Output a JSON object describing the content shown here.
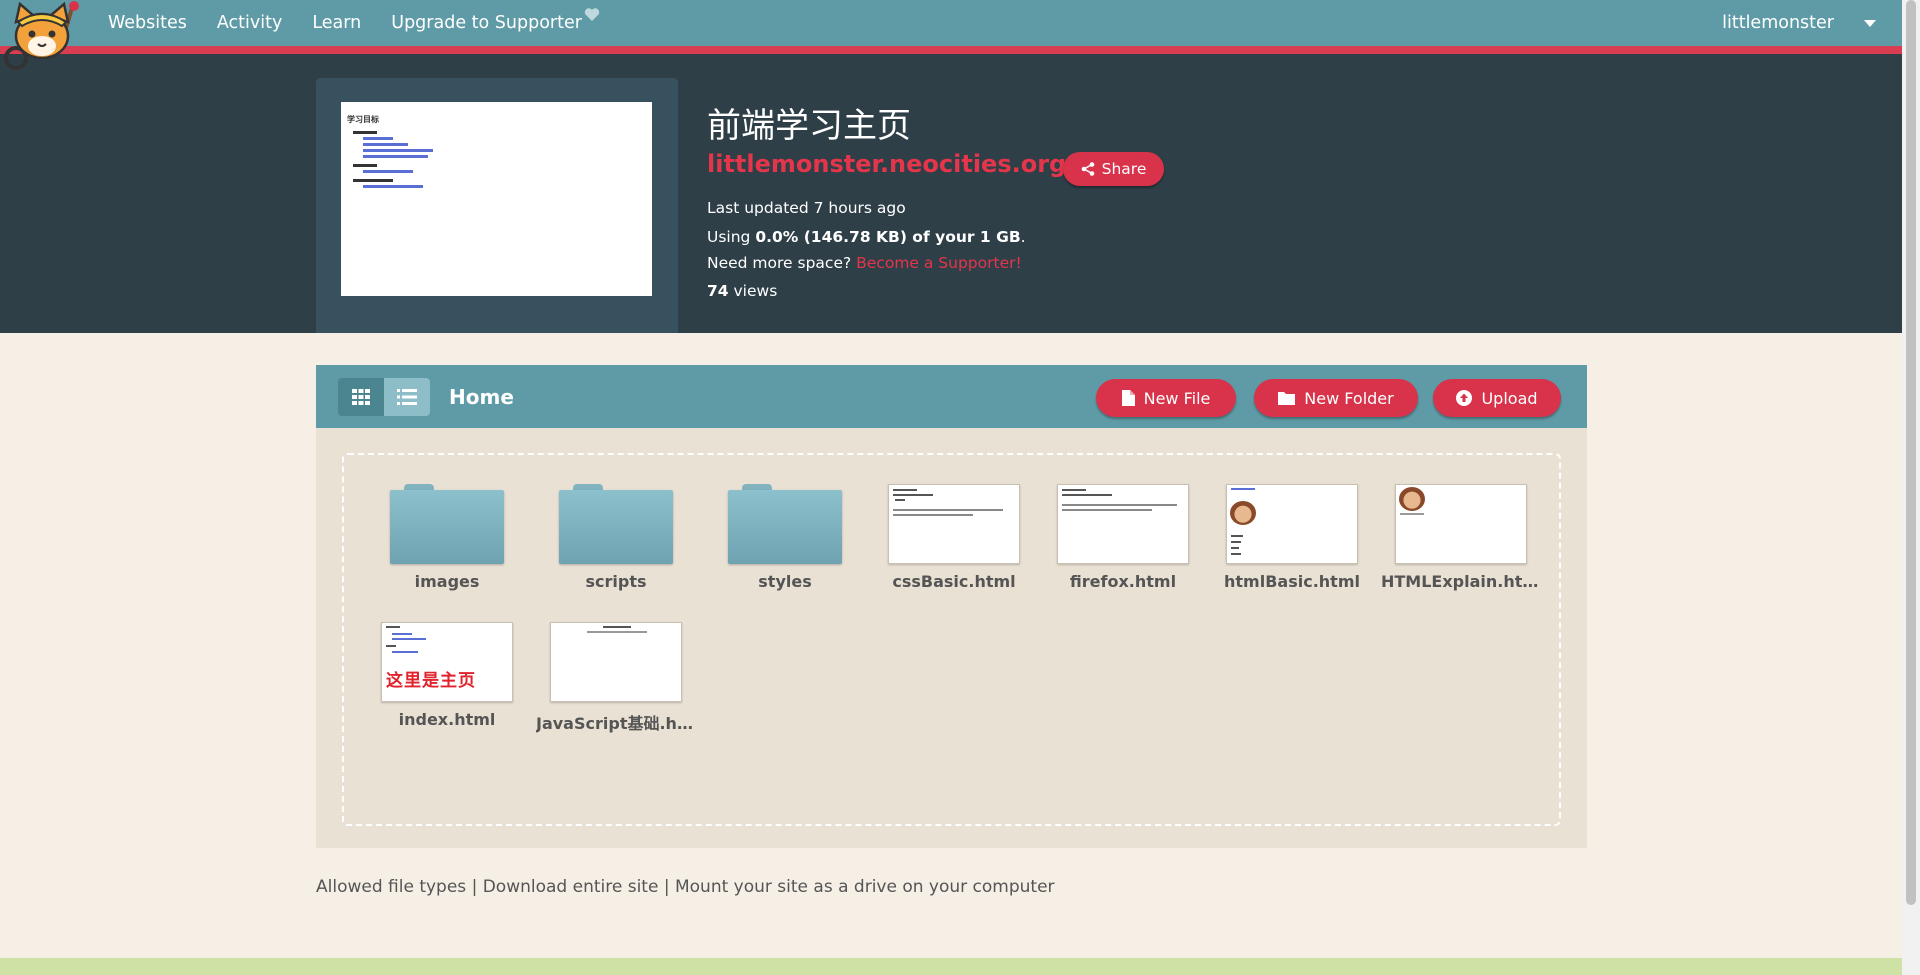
{
  "nav": {
    "items": [
      {
        "label": "Websites"
      },
      {
        "label": "Activity"
      },
      {
        "label": "Learn"
      },
      {
        "label": "Upgrade to Supporter"
      }
    ],
    "username": "littlemonster"
  },
  "site": {
    "title": "前端学习主页",
    "url": "littlemonster.neocities.org",
    "share_label": "Share",
    "last_updated": "Last updated 7 hours ago",
    "usage_prefix": "Using ",
    "usage_value": "0.0% (146.78 KB) of your 1 GB",
    "usage_suffix": ".",
    "space_prompt": "Need more space? ",
    "supporter_link": "Become a Supporter!",
    "views_count": "74",
    "views_label": " views",
    "thumb_heading": "学习目标"
  },
  "file_manager": {
    "title": "Home",
    "new_file_label": "New File",
    "new_folder_label": "New Folder",
    "upload_label": "Upload",
    "items": [
      {
        "name": "images",
        "kind": "folder"
      },
      {
        "name": "scripts",
        "kind": "folder"
      },
      {
        "name": "styles",
        "kind": "folder"
      },
      {
        "name": "cssBasic.html",
        "kind": "file"
      },
      {
        "name": "firefox.html",
        "kind": "file"
      },
      {
        "name": "htmlBasic.html",
        "kind": "file"
      },
      {
        "name": "HTMLExplain.html",
        "kind": "file"
      },
      {
        "name": "index.html",
        "kind": "file",
        "preview_text": "这里是主页"
      },
      {
        "name": "JavaScript基础.ht...",
        "kind": "file"
      }
    ]
  },
  "footer": {
    "allowed_types": "Allowed file types",
    "download_site": "Download entire site",
    "mount_drive": "Mount your site as a drive on your computer",
    "separator": " | "
  },
  "colors": {
    "nav_bg": "#5f9ba6",
    "accent_red": "#d8334b",
    "header_bg": "#2f3f48",
    "page_bg": "#f6efe6"
  }
}
